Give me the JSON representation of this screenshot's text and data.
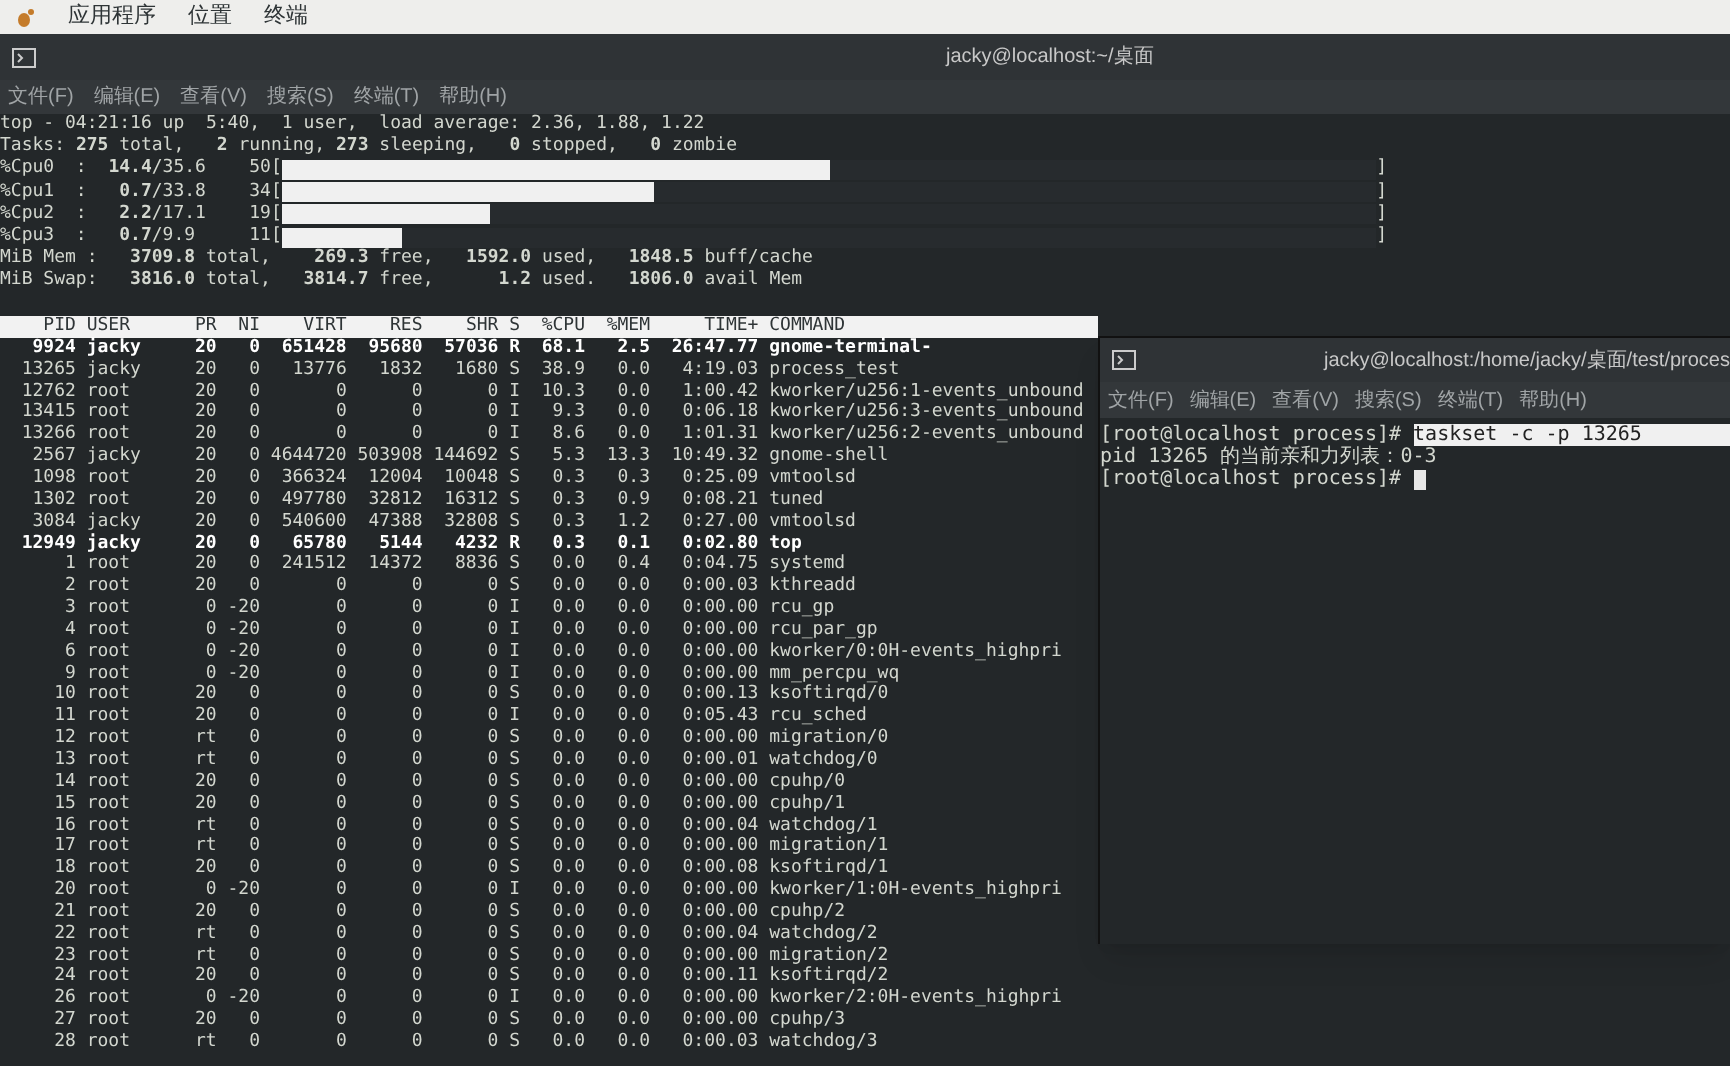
{
  "menubar": {
    "items": [
      "应用程序",
      "位置",
      "终端"
    ]
  },
  "terminal": {
    "title": "jacky@localhost:~/桌面",
    "menu": [
      "文件(F)",
      "编辑(E)",
      "查看(V)",
      "搜索(S)",
      "终端(T)",
      "帮助(H)"
    ],
    "summary": {
      "uptime_line": "top - 04:21:16 up  5:40,  1 user,  load average: 2.36, 1.88, 1.22",
      "tasks_line": "Tasks: **275** total,   **2** running, **273** sleeping,   **0** stopped,   **0** zombie",
      "cpus": [
        {
          "text": "%Cpu0  :  **14.4**/35.6    50[",
          "level": 0.5,
          "close": "]"
        },
        {
          "text": "%Cpu1  :   **0.7**/33.8    34[",
          "level": 0.34,
          "close": "]"
        },
        {
          "text": "%Cpu2  :   **2.2**/17.1    19[",
          "level": 0.19,
          "close": "]"
        },
        {
          "text": "%Cpu3  :   **0.7**/9.9     11[",
          "level": 0.11,
          "close": "]"
        }
      ],
      "mem_lines": [
        "MiB Mem :   **3709.8** total,    **269.3** free,   **1592.0** used,   **1848.5** buff/cache",
        "MiB Swap:   **3816.0** total,   **3814.7** free,      **1.2** used.   **1806.0** avail Mem"
      ]
    },
    "table": {
      "columns": [
        "PID",
        "USER",
        "PR",
        "NI",
        "VIRT",
        "RES",
        "SHR",
        "S",
        "%CPU",
        "%MEM",
        "TIME+",
        "COMMAND"
      ],
      "rows": [
        {
          "cells": [
            "9924",
            "jacky",
            "20",
            "0",
            "651428",
            "95680",
            "57036",
            "R",
            "68.1",
            "2.5",
            "26:47.77",
            "gnome-terminal-"
          ],
          "highlighted": true
        },
        {
          "cells": [
            "13265",
            "jacky",
            "20",
            "0",
            "13776",
            "1832",
            "1680",
            "S",
            "38.9",
            "0.0",
            "4:19.03",
            "process_test"
          ],
          "highlighted": false
        },
        {
          "cells": [
            "12762",
            "root",
            "20",
            "0",
            "0",
            "0",
            "0",
            "I",
            "10.3",
            "0.0",
            "1:00.42",
            "kworker/u256:1-events_unbound"
          ],
          "highlighted": false
        },
        {
          "cells": [
            "13415",
            "root",
            "20",
            "0",
            "0",
            "0",
            "0",
            "I",
            "9.3",
            "0.0",
            "0:06.18",
            "kworker/u256:3-events_unbound"
          ],
          "highlighted": false
        },
        {
          "cells": [
            "13266",
            "root",
            "20",
            "0",
            "0",
            "0",
            "0",
            "I",
            "8.6",
            "0.0",
            "1:01.31",
            "kworker/u256:2-events_unbound"
          ],
          "highlighted": false
        },
        {
          "cells": [
            "2567",
            "jacky",
            "20",
            "0",
            "4644720",
            "503908",
            "144692",
            "S",
            "5.3",
            "13.3",
            "10:49.32",
            "gnome-shell"
          ],
          "highlighted": false
        },
        {
          "cells": [
            "1098",
            "root",
            "20",
            "0",
            "366324",
            "12004",
            "10048",
            "S",
            "0.3",
            "0.3",
            "0:25.09",
            "vmtoolsd"
          ],
          "highlighted": false
        },
        {
          "cells": [
            "1302",
            "root",
            "20",
            "0",
            "497780",
            "32812",
            "16312",
            "S",
            "0.3",
            "0.9",
            "0:08.21",
            "tuned"
          ],
          "highlighted": false
        },
        {
          "cells": [
            "3084",
            "jacky",
            "20",
            "0",
            "540600",
            "47388",
            "32808",
            "S",
            "0.3",
            "1.2",
            "0:27.00",
            "vmtoolsd"
          ],
          "highlighted": false
        },
        {
          "cells": [
            "12949",
            "jacky",
            "20",
            "0",
            "65780",
            "5144",
            "4232",
            "R",
            "0.3",
            "0.1",
            "0:02.80",
            "top"
          ],
          "highlighted": true
        },
        {
          "cells": [
            "1",
            "root",
            "20",
            "0",
            "241512",
            "14372",
            "8836",
            "S",
            "0.0",
            "0.4",
            "0:04.75",
            "systemd"
          ],
          "highlighted": false
        },
        {
          "cells": [
            "2",
            "root",
            "20",
            "0",
            "0",
            "0",
            "0",
            "S",
            "0.0",
            "0.0",
            "0:00.03",
            "kthreadd"
          ],
          "highlighted": false
        },
        {
          "cells": [
            "3",
            "root",
            "0",
            "-20",
            "0",
            "0",
            "0",
            "I",
            "0.0",
            "0.0",
            "0:00.00",
            "rcu_gp"
          ],
          "highlighted": false
        },
        {
          "cells": [
            "4",
            "root",
            "0",
            "-20",
            "0",
            "0",
            "0",
            "I",
            "0.0",
            "0.0",
            "0:00.00",
            "rcu_par_gp"
          ],
          "highlighted": false
        },
        {
          "cells": [
            "6",
            "root",
            "0",
            "-20",
            "0",
            "0",
            "0",
            "I",
            "0.0",
            "0.0",
            "0:00.00",
            "kworker/0:0H-events_highpri"
          ],
          "highlighted": false
        },
        {
          "cells": [
            "9",
            "root",
            "0",
            "-20",
            "0",
            "0",
            "0",
            "I",
            "0.0",
            "0.0",
            "0:00.00",
            "mm_percpu_wq"
          ],
          "highlighted": false
        },
        {
          "cells": [
            "10",
            "root",
            "20",
            "0",
            "0",
            "0",
            "0",
            "S",
            "0.0",
            "0.0",
            "0:00.13",
            "ksoftirqd/0"
          ],
          "highlighted": false
        },
        {
          "cells": [
            "11",
            "root",
            "20",
            "0",
            "0",
            "0",
            "0",
            "I",
            "0.0",
            "0.0",
            "0:05.43",
            "rcu_sched"
          ],
          "highlighted": false
        },
        {
          "cells": [
            "12",
            "root",
            "rt",
            "0",
            "0",
            "0",
            "0",
            "S",
            "0.0",
            "0.0",
            "0:00.00",
            "migration/0"
          ],
          "highlighted": false
        },
        {
          "cells": [
            "13",
            "root",
            "rt",
            "0",
            "0",
            "0",
            "0",
            "S",
            "0.0",
            "0.0",
            "0:00.01",
            "watchdog/0"
          ],
          "highlighted": false
        },
        {
          "cells": [
            "14",
            "root",
            "20",
            "0",
            "0",
            "0",
            "0",
            "S",
            "0.0",
            "0.0",
            "0:00.00",
            "cpuhp/0"
          ],
          "highlighted": false
        },
        {
          "cells": [
            "15",
            "root",
            "20",
            "0",
            "0",
            "0",
            "0",
            "S",
            "0.0",
            "0.0",
            "0:00.00",
            "cpuhp/1"
          ],
          "highlighted": false
        },
        {
          "cells": [
            "16",
            "root",
            "rt",
            "0",
            "0",
            "0",
            "0",
            "S",
            "0.0",
            "0.0",
            "0:00.04",
            "watchdog/1"
          ],
          "highlighted": false
        },
        {
          "cells": [
            "17",
            "root",
            "rt",
            "0",
            "0",
            "0",
            "0",
            "S",
            "0.0",
            "0.0",
            "0:00.00",
            "migration/1"
          ],
          "highlighted": false
        },
        {
          "cells": [
            "18",
            "root",
            "20",
            "0",
            "0",
            "0",
            "0",
            "S",
            "0.0",
            "0.0",
            "0:00.08",
            "ksoftirqd/1"
          ],
          "highlighted": false
        },
        {
          "cells": [
            "20",
            "root",
            "0",
            "-20",
            "0",
            "0",
            "0",
            "I",
            "0.0",
            "0.0",
            "0:00.00",
            "kworker/1:0H-events_highpri"
          ],
          "highlighted": false
        },
        {
          "cells": [
            "21",
            "root",
            "20",
            "0",
            "0",
            "0",
            "0",
            "S",
            "0.0",
            "0.0",
            "0:00.00",
            "cpuhp/2"
          ],
          "highlighted": false
        },
        {
          "cells": [
            "22",
            "root",
            "rt",
            "0",
            "0",
            "0",
            "0",
            "S",
            "0.0",
            "0.0",
            "0:00.04",
            "watchdog/2"
          ],
          "highlighted": false
        },
        {
          "cells": [
            "23",
            "root",
            "rt",
            "0",
            "0",
            "0",
            "0",
            "S",
            "0.0",
            "0.0",
            "0:00.00",
            "migration/2"
          ],
          "highlighted": false
        },
        {
          "cells": [
            "24",
            "root",
            "20",
            "0",
            "0",
            "0",
            "0",
            "S",
            "0.0",
            "0.0",
            "0:00.11",
            "ksoftirqd/2"
          ],
          "highlighted": false
        },
        {
          "cells": [
            "26",
            "root",
            "0",
            "-20",
            "0",
            "0",
            "0",
            "I",
            "0.0",
            "0.0",
            "0:00.00",
            "kworker/2:0H-events_highpri"
          ],
          "highlighted": false
        },
        {
          "cells": [
            "27",
            "root",
            "20",
            "0",
            "0",
            "0",
            "0",
            "S",
            "0.0",
            "0.0",
            "0:00.00",
            "cpuhp/3"
          ],
          "highlighted": false
        },
        {
          "cells": [
            "28",
            "root",
            "rt",
            "0",
            "0",
            "0",
            "0",
            "S",
            "0.0",
            "0.0",
            "0:00.03",
            "watchdog/3"
          ],
          "highlighted": false
        }
      ]
    }
  },
  "second_terminal": {
    "title": "jacky@localhost:/home/jacky/桌面/test/proces",
    "menu": [
      "文件(F)",
      "编辑(E)",
      "查看(V)",
      "搜索(S)",
      "终端(T)",
      "帮助(H)"
    ],
    "lines": [
      {
        "kind": "prompt",
        "prompt": "[root@localhost process]#",
        "command": "taskset -c -p 13265",
        "highlighted": true,
        "cursor": false
      },
      {
        "kind": "output",
        "text": "pid 13265 的当前亲和力列表：0-3"
      },
      {
        "kind": "prompt",
        "prompt": "[root@localhost process]#",
        "cursor": true
      }
    ]
  }
}
